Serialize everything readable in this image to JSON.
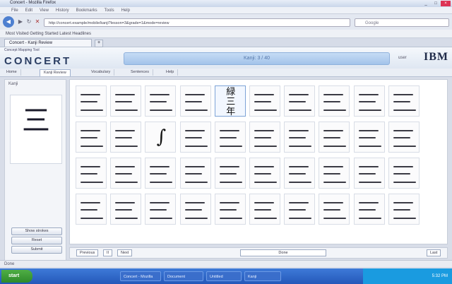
{
  "window": {
    "title": "Concert - Mozilla Firefox"
  },
  "menu": [
    "File",
    "Edit",
    "View",
    "History",
    "Bookmarks",
    "Tools",
    "Help"
  ],
  "toolbar": {
    "url": "http://concert.example/mobile/kanji?lesson=3&grade=1&mode=review",
    "search_placeholder": "Google"
  },
  "bookmarks_text": "Most Visited   Getting Started   Latest Headlines",
  "tabs": [
    {
      "label": "Concert - Kanji Review"
    }
  ],
  "header": {
    "small_text": "Concept Mapping Tool",
    "logo": "CONCERT",
    "banner_text": "Kanji: 3 / 40",
    "user": "user",
    "brand": "IBM"
  },
  "subnav": [
    "Home",
    "Kanji Review",
    "Vocabulary",
    "Sentences",
    "Help"
  ],
  "left_panel": {
    "title": "Kanji",
    "big_char": "三",
    "buttons": [
      "Show strokes",
      "Reset",
      "Submit"
    ]
  },
  "grid": {
    "rows": 4,
    "cols": 10,
    "selected_index": 4,
    "selected_chars": [
      "緑",
      "三",
      "年"
    ],
    "special_index": 12,
    "special_char": "∫"
  },
  "pager": {
    "prev": "Previous",
    "page": "II",
    "next": "Next",
    "middle": "Done",
    "last": "Last"
  },
  "status": "Done",
  "taskbar": {
    "start": "start",
    "tasks": [
      "Concert - Mozilla",
      "Document",
      "Untitled",
      "Kanji"
    ],
    "clock": "5:32 PM"
  }
}
